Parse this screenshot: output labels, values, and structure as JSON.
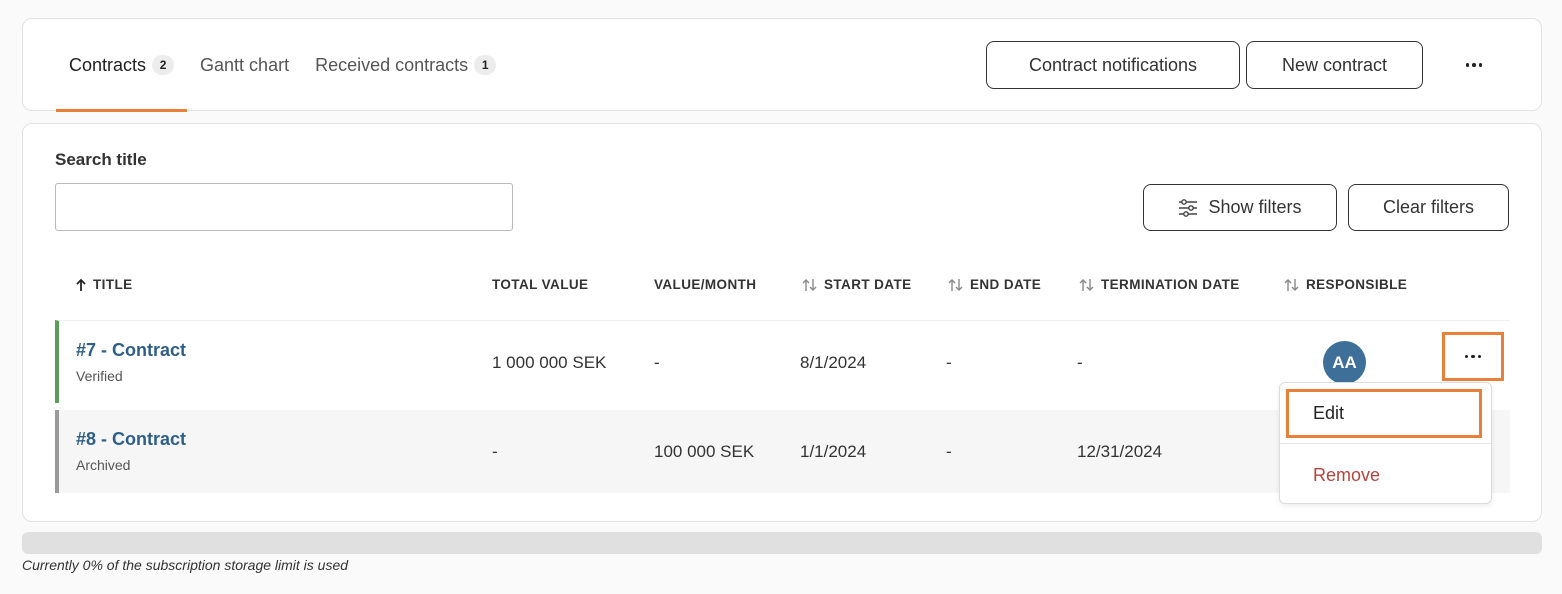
{
  "tabs": [
    {
      "label": "Contracts",
      "count": "2",
      "active": true
    },
    {
      "label": "Gantt chart",
      "active": false
    },
    {
      "label": "Received contracts",
      "count": "1",
      "active": false
    }
  ],
  "header": {
    "notifications_label": "Contract notifications",
    "new_contract_label": "New contract"
  },
  "search": {
    "label": "Search title",
    "value": "",
    "placeholder": ""
  },
  "filters": {
    "show_label": "Show filters",
    "clear_label": "Clear filters"
  },
  "table": {
    "columns": [
      "TITLE",
      "TOTAL VALUE",
      "VALUE/MONTH",
      "START DATE",
      "END DATE",
      "TERMINATION DATE",
      "RESPONSIBLE"
    ],
    "rows": [
      {
        "title": "#7 - Contract",
        "status": "Verified",
        "total_value": "1 000 000 SEK",
        "value_month": "-",
        "start_date": "8/1/2024",
        "end_date": "-",
        "termination_date": "-",
        "responsible": "AA",
        "status_color": "#5a9e5a"
      },
      {
        "title": "#8 - Contract",
        "status": "Archived",
        "total_value": "-",
        "value_month": "100 000 SEK",
        "start_date": "1/1/2024",
        "end_date": "-",
        "termination_date": "12/31/2024",
        "responsible": "",
        "status_color": "#9a9a9a"
      }
    ]
  },
  "row_menu": {
    "edit_label": "Edit",
    "remove_label": "Remove"
  },
  "storage": {
    "used_fraction": 0,
    "text": "Currently 0% of the subscription storage limit is used"
  },
  "colors": {
    "accent": "#e8803a",
    "link": "#2f5f86",
    "avatar": "#3d6f98",
    "danger": "#b5443b"
  },
  "icons": [
    "sort-ascending-icon",
    "sort-icon",
    "filter-sliders-icon",
    "more-horizontal-icon"
  ]
}
